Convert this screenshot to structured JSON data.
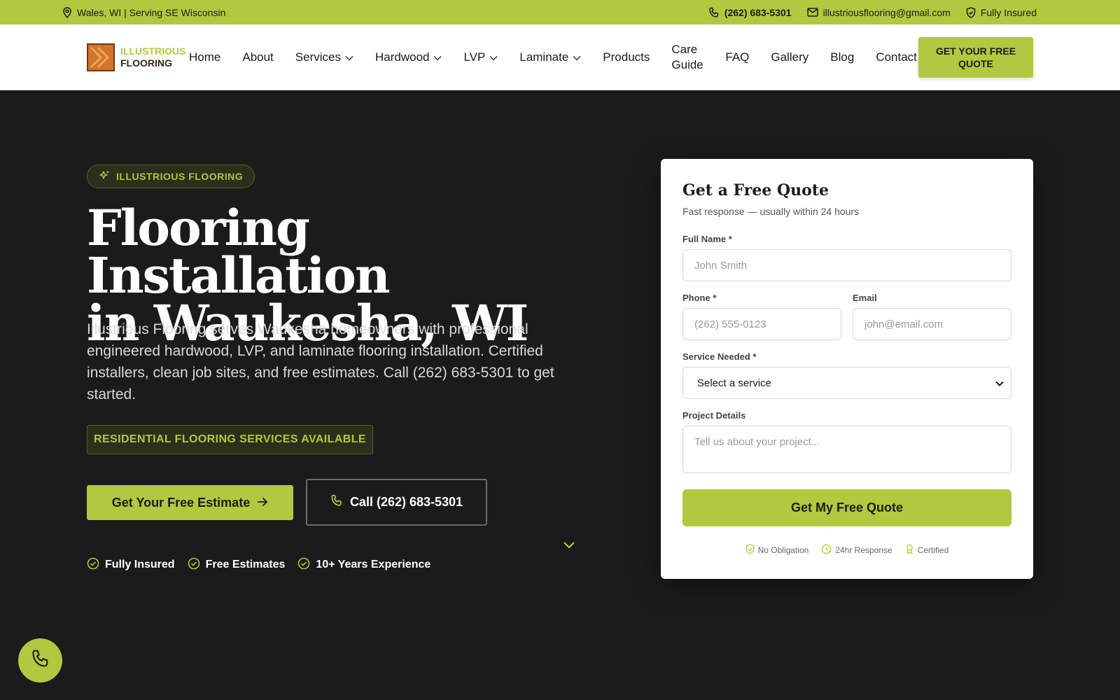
{
  "topbar": {
    "location": "Wales, WI | Serving SE Wisconsin",
    "phone": "(262) 683-5301",
    "email": "illustriousflooring@gmail.com",
    "insured": "Fully Insured"
  },
  "logo": {
    "line1": "ILLUSTRIOUS",
    "line2": "FLOORING"
  },
  "nav": {
    "home": "Home",
    "about": "About",
    "services": "Services",
    "hardwood": "Hardwood",
    "lvp": "LVP",
    "laminate": "Laminate",
    "products": "Products",
    "care_guide": "Care Guide",
    "faq": "FAQ",
    "gallery": "Gallery",
    "blog": "Blog",
    "contact": "Contact"
  },
  "header": {
    "cta": "GET YOUR FREE QUOTE"
  },
  "hero": {
    "badge": "ILLUSTRIOUS FLOORING",
    "title_line1": "Flooring Installation",
    "title_line2": "in Waukesha, WI",
    "description": "Illustrious Flooring serves Waukesha homeowners with professional engineered hardwood, LVP, and laminate flooring installation. Certified installers, clean job sites, and free estimates. Call (262) 683-5301 to get started.",
    "services_badge": "RESIDENTIAL FLOORING SERVICES AVAILABLE",
    "estimate_button": "Get Your Free Estimate",
    "call_button": "Call (262) 683-5301",
    "trust": [
      "Fully Insured",
      "Free Estimates",
      "10+ Years Experience"
    ]
  },
  "form": {
    "title": "Get a Free Quote",
    "subtitle": "Fast response — usually within 24 hours",
    "name_label": "Full Name *",
    "name_placeholder": "John Smith",
    "phone_label": "Phone *",
    "phone_placeholder": "(262) 555-0123",
    "email_label": "Email",
    "email_placeholder": "john@email.com",
    "service_label": "Service Needed *",
    "service_value": "Select a service",
    "details_label": "Project Details",
    "details_placeholder": "Tell us about your project...",
    "submit": "Get My Free Quote",
    "assurances": [
      "No Obligation",
      "24hr Response",
      "Certified"
    ]
  },
  "colors": {
    "accent": "#b0c93f",
    "background": "#1b1b1b",
    "logo_orange": "#d2742a"
  },
  "icons": {
    "topbar": [
      "map-pin-icon",
      "phone-icon",
      "mail-icon",
      "shield-icon"
    ],
    "floating": "phone-icon"
  }
}
